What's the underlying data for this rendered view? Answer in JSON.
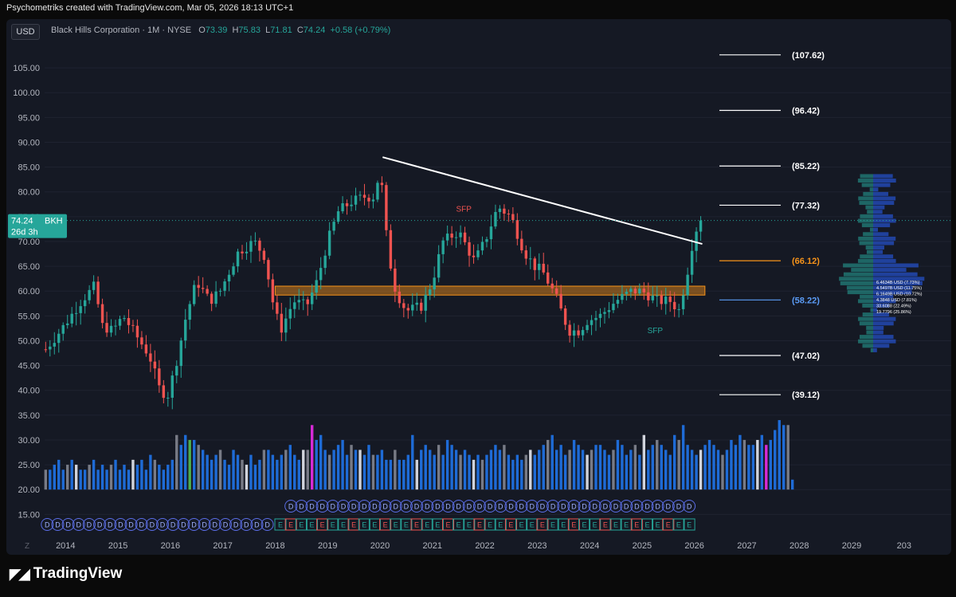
{
  "credit": "Psychometriks created with TradingView.com, Mar 05, 2026 18:13 UTC+1",
  "currency": "USD",
  "header": {
    "name": "Black Hills Corporation · 1M · NYSE",
    "o_label": "O",
    "o": "73.39",
    "h_label": "H",
    "h": "75.83",
    "l_label": "L",
    "l": "71.81",
    "c_label": "C",
    "c": "74.24",
    "change": "+0.58 (+0.79%)"
  },
  "price_tag": {
    "value": "74.24",
    "ticker": "BKH",
    "countdown": "26d 3h"
  },
  "footer_logo": "TradingView",
  "axis_corner": "Z",
  "colors": {
    "up": "#26a69a",
    "down": "#ef5350",
    "blue": "#1e6bd6",
    "grey": "#787b86",
    "magenta": "#d62ad6",
    "orange": "#f7931a",
    "white": "#ffffff",
    "green_vol": "#4caf50"
  },
  "chart_data": {
    "type": "candlestick",
    "ylim": [
      12,
      110
    ],
    "y_ticks": [
      "15.00",
      "20.00",
      "25.00",
      "30.00",
      "35.00",
      "40.00",
      "45.00",
      "50.00",
      "55.00",
      "60.00",
      "65.00",
      "70.00",
      "75.00",
      "80.00",
      "85.00",
      "90.00",
      "95.00",
      "100.00",
      "105.00"
    ],
    "x_labels": [
      "2014",
      "2015",
      "2016",
      "2017",
      "2018",
      "2019",
      "2020",
      "2021",
      "2022",
      "2023",
      "2024",
      "2025",
      "2026",
      "2027",
      "2028",
      "2029",
      "203"
    ],
    "x_range": [
      2013.6,
      2030.9
    ],
    "anchors": [
      [
        2013.6,
        48
      ],
      [
        2013.9,
        52
      ],
      [
        2014.3,
        58
      ],
      [
        2014.55,
        61
      ],
      [
        2014.7,
        53
      ],
      [
        2014.9,
        52
      ],
      [
        2015.1,
        55
      ],
      [
        2015.35,
        51
      ],
      [
        2015.6,
        47
      ],
      [
        2015.8,
        40
      ],
      [
        2015.95,
        39
      ],
      [
        2016.1,
        45
      ],
      [
        2016.3,
        55
      ],
      [
        2016.5,
        62
      ],
      [
        2016.75,
        58
      ],
      [
        2016.95,
        60
      ],
      [
        2017.3,
        68
      ],
      [
        2017.6,
        70
      ],
      [
        2017.8,
        67
      ],
      [
        2017.95,
        58
      ],
      [
        2018.1,
        52
      ],
      [
        2018.35,
        58
      ],
      [
        2018.6,
        57
      ],
      [
        2018.8,
        62
      ],
      [
        2019.0,
        70
      ],
      [
        2019.2,
        76
      ],
      [
        2019.45,
        78
      ],
      [
        2019.7,
        79
      ],
      [
        2019.9,
        79
      ],
      [
        2020.0,
        85
      ],
      [
        2020.15,
        68
      ],
      [
        2020.3,
        60
      ],
      [
        2020.5,
        56
      ],
      [
        2020.8,
        57
      ],
      [
        2021.0,
        62
      ],
      [
        2021.2,
        70
      ],
      [
        2021.5,
        72
      ],
      [
        2021.8,
        66
      ],
      [
        2022.0,
        70
      ],
      [
        2022.25,
        77
      ],
      [
        2022.5,
        75
      ],
      [
        2022.75,
        68
      ],
      [
        2022.95,
        65
      ],
      [
        2023.1,
        64
      ],
      [
        2023.35,
        59
      ],
      [
        2023.6,
        52
      ],
      [
        2023.8,
        52
      ],
      [
        2023.95,
        54
      ],
      [
        2024.2,
        55
      ],
      [
        2024.5,
        58
      ],
      [
        2024.8,
        60
      ],
      [
        2025.0,
        60
      ],
      [
        2025.3,
        58
      ],
      [
        2025.55,
        58
      ],
      [
        2025.7,
        56
      ],
      [
        2025.85,
        63
      ],
      [
        2026.0,
        72
      ],
      [
        2026.15,
        74.24
      ]
    ],
    "volume": [
      24,
      24,
      25,
      26,
      24,
      25,
      26,
      25,
      24,
      24,
      25,
      26,
      24,
      25,
      24,
      25,
      26,
      24,
      25,
      24,
      26,
      25,
      26,
      24,
      27,
      26,
      25,
      24,
      25,
      26,
      31,
      29,
      31,
      30,
      30,
      29,
      28,
      27,
      26,
      27,
      28,
      26,
      25,
      28,
      27,
      26,
      25,
      27,
      25,
      26,
      28,
      28,
      27,
      26,
      27,
      28,
      29,
      27,
      26,
      28,
      28,
      33,
      30,
      31,
      28,
      27,
      28,
      29,
      30,
      27,
      29,
      28,
      28,
      27,
      29,
      27,
      27,
      28,
      26,
      26,
      28,
      26,
      26,
      27,
      31,
      26,
      28,
      29,
      28,
      27,
      29,
      27,
      30,
      29,
      28,
      27,
      28,
      27,
      26,
      27,
      26,
      27,
      28,
      29,
      28,
      29,
      27,
      26,
      27,
      26,
      27,
      28,
      27,
      28,
      29,
      30,
      31,
      28,
      29,
      27,
      28,
      30,
      29,
      28,
      27,
      28,
      29,
      29,
      28,
      27,
      28,
      30,
      29,
      27,
      28,
      29,
      27,
      31,
      28,
      29,
      30,
      29,
      28,
      27,
      31,
      30,
      33,
      29,
      28,
      27,
      28,
      29,
      30,
      29,
      28,
      27,
      28,
      30,
      29,
      31,
      30,
      29,
      29,
      30,
      31,
      29,
      30,
      32,
      34,
      33,
      33,
      22
    ],
    "volume_highlights": {
      "33": "green_vol",
      "61": "magenta",
      "165": "magenta"
    },
    "levels": [
      {
        "label": "(107.62)",
        "value": 107.62,
        "color": "#ffffff"
      },
      {
        "label": "(96.42)",
        "value": 96.42,
        "color": "#ffffff"
      },
      {
        "label": "(85.22)",
        "value": 85.22,
        "color": "#ffffff"
      },
      {
        "label": "(77.32)",
        "value": 77.32,
        "color": "#ffffff"
      },
      {
        "label": "(66.12)",
        "value": 66.12,
        "color": "#f7931a"
      },
      {
        "label": "(58.22)",
        "value": 58.22,
        "color": "#5b9cf6"
      },
      {
        "label": "(47.02)",
        "value": 47.02,
        "color": "#ffffff"
      },
      {
        "label": "(39.12)",
        "value": 39.12,
        "color": "#ffffff"
      }
    ],
    "trendline": {
      "from": [
        2020.05,
        87.0
      ],
      "to": [
        2026.15,
        69.5
      ]
    },
    "zone": {
      "from_x": 2018.0,
      "to_x": 2026.2,
      "y_low": 59.2,
      "y_high": 61.0
    },
    "annotations": [
      {
        "text": "SFP",
        "x": 2021.6,
        "y": 76,
        "color": "#ef5350"
      },
      {
        "text": "SFP",
        "x": 2025.25,
        "y": 51.5,
        "color": "#26a69a"
      }
    ],
    "dividend_markers": {
      "label": "D",
      "row_high_x": [
        2018.3,
        2026.1
      ],
      "row_low_x": [
        2013.65,
        2018.0
      ]
    },
    "earnings_markers": {
      "label": "E",
      "x": [
        2018.1,
        2026.0
      ]
    },
    "volume_profile_labels": [
      "6.4634B USD (7.73%)",
      "4.5497B USD (11.75%)",
      "6.1649B USD (10.72%)",
      "4.3848 USD (7.81%)",
      "33.6088 (22.49%)",
      "19.7796 (25.86%)"
    ]
  }
}
